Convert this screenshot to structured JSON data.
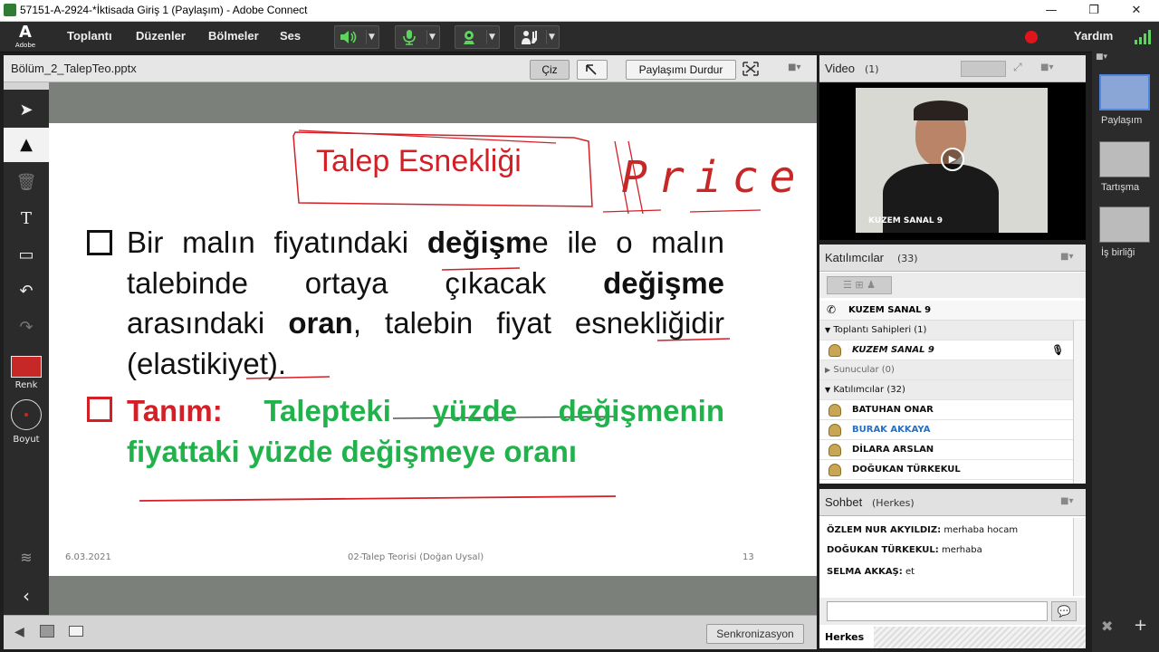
{
  "window": {
    "title": "57151-A-2924-*İktisada Giriş 1 (Paylaşım) - Adobe Connect",
    "min": "—",
    "restore": "❐",
    "close": "✕"
  },
  "menubar": {
    "logo_letter": "A",
    "logo_text": "Adobe",
    "items": [
      "Toplantı",
      "Düzenler",
      "Bölmeler",
      "Ses"
    ],
    "help": "Yardım",
    "colors": {
      "speaker": "#5fd35f",
      "mic": "#5fd35f",
      "camera": "#5fd35f",
      "rec": "#e0151b"
    }
  },
  "share": {
    "file_name": "Bölüm_2_TalepTeo.pptx",
    "draw_button": "Çiz",
    "stop_sharing": "Paylaşımı Durdur",
    "sync_button": "Senkronizasyon",
    "color_label": "Renk",
    "size_label": "Boyut"
  },
  "slide": {
    "title": "Talep Esnekliği",
    "handwriting": "Price",
    "bullet1": [
      "Bir malın fiyatındaki ",
      "değişm",
      "e ile o malın talebinde ortaya çıkacak ",
      "değişme",
      " arasındaki ",
      "oran",
      ", talebin fiyat esnekliğidir (elastikiyet)."
    ],
    "bullet2_label": "Tanım:",
    "bullet2_text": "Talepteki yüzde değişmenin fiyattaki yüzde değişmeye oranı",
    "footer_date": "6.03.2021",
    "footer_center": "02-Talep Teorisi (Doğan Uysal)",
    "footer_page": "13"
  },
  "video": {
    "title": "Video",
    "count": "(1)",
    "person_name": "KUZEM SANAL 9"
  },
  "attendees": {
    "title": "Katılımcılar",
    "count": "(33)",
    "me": "KUZEM SANAL 9",
    "groups": [
      {
        "label": "Toplantı Sahipleri (1)",
        "open": true
      },
      {
        "label": "Sunucular (0)",
        "open": false
      },
      {
        "label": "Katılımcılar (32)",
        "open": true
      }
    ],
    "host": "KUZEM SANAL 9",
    "participants": [
      "BATUHAN ONAR",
      "BURAK AKKAYA",
      "DİLARA ARSLAN",
      "DOĞUKAN TÜRKEKUL"
    ]
  },
  "chat": {
    "title": "Sohbet",
    "scope": "(Herkes)",
    "messages": [
      {
        "name": "ÖZLEM NUR AKYILDIZ:",
        "text": "merhaba hocam"
      },
      {
        "name": "DOĞUKAN TÜRKEKUL:",
        "text": "merhaba"
      },
      {
        "name": "SELMA AKKAŞ:",
        "text": "et"
      }
    ],
    "tab": "Herkes"
  },
  "layouts": [
    "Paylaşım",
    "Tartışma",
    "İş birliği"
  ]
}
